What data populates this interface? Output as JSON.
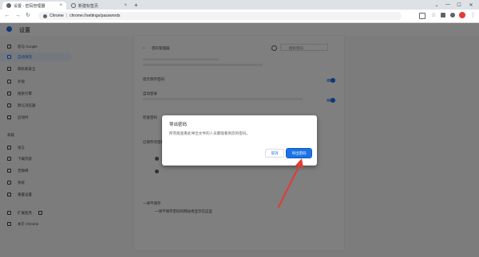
{
  "tabs": [
    {
      "title": "设置 - 密码管理器",
      "close": "×"
    },
    {
      "title": "新建标签页",
      "close": "×"
    }
  ],
  "new_tab_label": "+",
  "window_controls": [
    "⌄",
    "—",
    "☐",
    "✕"
  ],
  "toolbar": {
    "back": "←",
    "forward": "→",
    "reload": "↻",
    "url_scheme": "Chrome",
    "url_separator": "|",
    "url": "chrome://settings/passwords"
  },
  "settings": {
    "title": "设置",
    "sidebar": [
      {
        "label": "您与 Google"
      },
      {
        "label": "自动填充",
        "active": true
      },
      {
        "label": "隐私和安全"
      },
      {
        "label": "外观"
      },
      {
        "label": "搜索引擎"
      },
      {
        "label": "默认浏览器"
      },
      {
        "label": "启动时"
      },
      {
        "label": "高级"
      },
      {
        "label": "语言"
      },
      {
        "label": "下载内容"
      },
      {
        "label": "无障碍"
      },
      {
        "label": "系统"
      },
      {
        "label": "重置设置"
      },
      {
        "label": "扩展程序"
      },
      {
        "label": "关于 Chrome"
      }
    ],
    "passwords": {
      "heading": "密码管理器",
      "search_placeholder": "搜索密码",
      "row_offer_save": "提示保存密码",
      "row_auto_signin": "自动登录",
      "row_check": "检查密码",
      "row_saved": "已保存的密码",
      "row_never": "一律不保存",
      "never_desc": "一律不保存密码的网站将显示在这里"
    }
  },
  "dialog": {
    "title": "导出密码",
    "body": "所有能查看此导出文件的人员都能看到您的密码。",
    "cancel": "取消",
    "export": "导出密码"
  },
  "colors": {
    "accent": "#1a73e8",
    "annotation_arrow": "#e53935"
  }
}
